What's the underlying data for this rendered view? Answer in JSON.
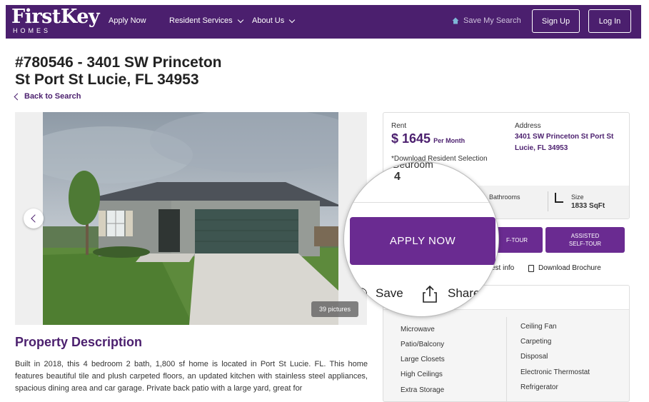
{
  "nav": {
    "logo_main": "FirstKey",
    "logo_sub": "HOMES",
    "apply": "Apply Now",
    "resident": "Resident Services",
    "about": "About Us",
    "save_search": "Save My Search",
    "signup": "Sign Up",
    "login": "Log In"
  },
  "listing": {
    "title_line1": "#780546 - 3401 SW Princeton",
    "title_line2": "St Port St Lucie, FL 34953",
    "back": "Back to Search",
    "pictures": "39 pictures"
  },
  "description": {
    "heading": "Property Description",
    "text": "Built in 2018, this 4 bedroom 2 bath, 1,800 sf home is located in Port St Lucie. FL. This home features beautiful tile and plush carpeted floors, an updated kitchen with stainless steel appliances, spacious dining area and car garage. Private back patio with a large yard, great for"
  },
  "details": {
    "rent_label": "Rent",
    "rent_value": "$ 1645",
    "rent_unit": "Per Month",
    "address_label": "Address",
    "address_value": "3401 SW Princeton St Port St Lucie, FL 34953",
    "download_label": "*Download Resident Selection",
    "bathrooms_label": "Bathrooms",
    "size_label": "Size",
    "size_value": "1833 SqFt"
  },
  "actions": {
    "tour_partial": "F-TOUR",
    "assisted_tour": "ASSISTED SELF-TOUR",
    "request_info_partial": "est info",
    "download_brochure": "Download Brochure"
  },
  "amenities": {
    "left": [
      "Microwave",
      "Patio/Balcony",
      "Large Closets",
      "High Ceilings",
      "Extra Storage"
    ],
    "right": [
      "Ceiling Fan",
      "Carpeting",
      "Disposal",
      "Electronic Thermostat",
      "Refrigerator"
    ]
  },
  "magnifier": {
    "bedrooms_label": "Bedroom",
    "bedrooms_value": "4",
    "apply_now": "APPLY NOW",
    "save": "Save",
    "share": "Share"
  },
  "colors": {
    "brand_purple": "#4b1f6e",
    "button_purple": "#6a2b91"
  }
}
